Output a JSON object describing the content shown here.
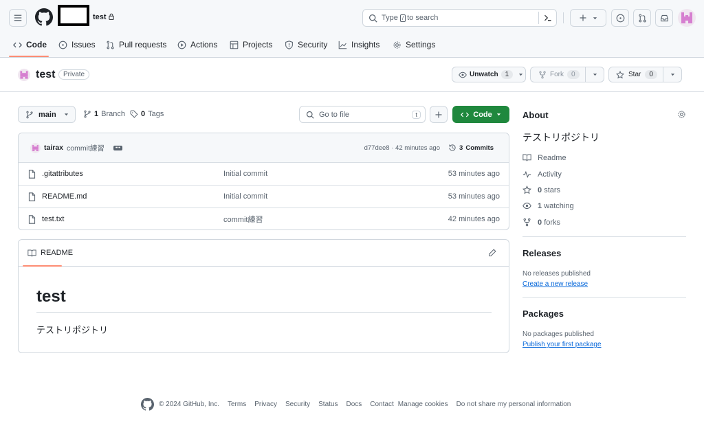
{
  "header": {
    "repo_name": "test",
    "search_placeholder_pre": "Type",
    "search_key": "/",
    "search_placeholder_post": "to search"
  },
  "tabs": [
    {
      "label": "Code",
      "icon": "code-icon"
    },
    {
      "label": "Issues",
      "icon": "issue-icon"
    },
    {
      "label": "Pull requests",
      "icon": "pull-request-icon"
    },
    {
      "label": "Actions",
      "icon": "play-icon"
    },
    {
      "label": "Projects",
      "icon": "table-icon"
    },
    {
      "label": "Security",
      "icon": "shield-icon"
    },
    {
      "label": "Insights",
      "icon": "graph-icon"
    },
    {
      "label": "Settings",
      "icon": "gear-icon"
    }
  ],
  "repo": {
    "title": "test",
    "visibility": "Private",
    "unwatch_label": "Unwatch",
    "watch_count": "1",
    "fork_label": "Fork",
    "fork_count": "0",
    "star_label": "Star",
    "star_count": "0"
  },
  "toolbar": {
    "branch": "main",
    "branch_count": "1",
    "branch_label": "Branch",
    "tag_count": "0",
    "tag_label": "Tags",
    "goto_placeholder": "Go to file",
    "goto_key": "t",
    "code_label": "Code"
  },
  "commit": {
    "author": "tairax",
    "message": "commit練習",
    "hash": "d77dee8",
    "sep": "·",
    "time": "42 minutes ago",
    "commits_count": "3",
    "commits_label": "Commits"
  },
  "files": [
    {
      "name": ".gitattributes",
      "message": "Initial commit",
      "time": "53 minutes ago"
    },
    {
      "name": "README.md",
      "message": "Initial commit",
      "time": "53 minutes ago"
    },
    {
      "name": "test.txt",
      "message": "commit練習",
      "time": "42 minutes ago"
    }
  ],
  "readme": {
    "tab": "README",
    "heading": "test",
    "body": "テストリポジトリ"
  },
  "about": {
    "title": "About",
    "description": "テストリポジトリ",
    "items": [
      {
        "icon": "book-icon",
        "label": "Readme"
      },
      {
        "icon": "pulse-icon",
        "label": "Activity"
      },
      {
        "icon": "star-icon",
        "count": "0",
        "label": "stars"
      },
      {
        "icon": "eye-icon",
        "count": "1",
        "label": "watching"
      },
      {
        "icon": "fork-icon",
        "count": "0",
        "label": "forks"
      }
    ]
  },
  "releases": {
    "title": "Releases",
    "empty": "No releases published",
    "link": "Create a new release"
  },
  "packages": {
    "title": "Packages",
    "empty": "No packages published",
    "link": "Publish your first package"
  },
  "footer": {
    "copyright": "© 2024 GitHub, Inc.",
    "links": [
      "Terms",
      "Privacy",
      "Security",
      "Status",
      "Docs",
      "Contact",
      "Manage cookies",
      "Do not share my personal information"
    ]
  }
}
